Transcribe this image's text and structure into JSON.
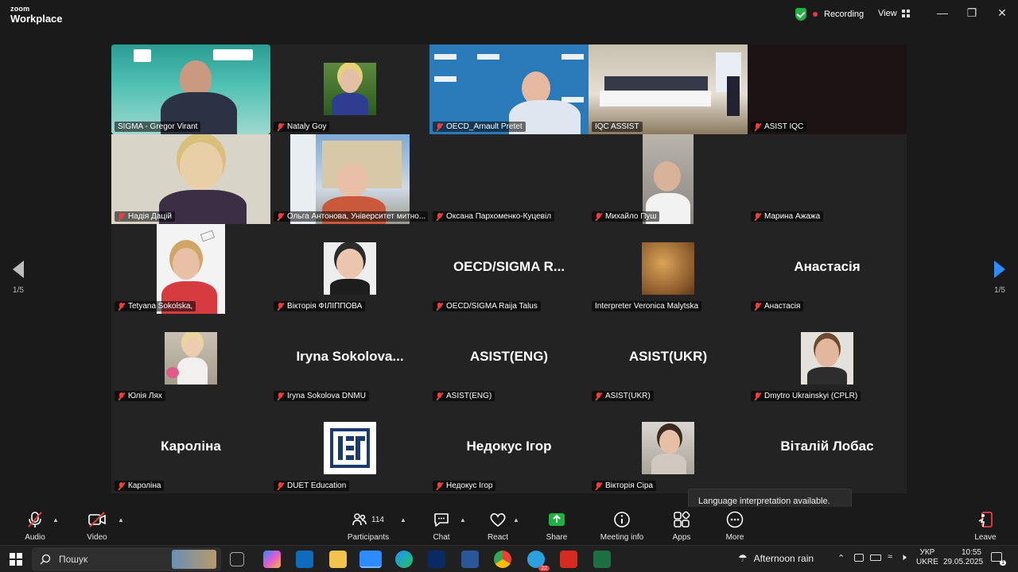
{
  "app": {
    "brand_top": "zoom",
    "brand_bottom": "Workplace"
  },
  "titlebar": {
    "recording": "Recording",
    "view": "View"
  },
  "pagination": {
    "left": "1/5",
    "right": "1/5"
  },
  "participants": [
    {
      "name": "SIGMA - Gregor Virant",
      "type": "video",
      "active": true,
      "muted": false
    },
    {
      "name": "Nataly Goy",
      "type": "photo",
      "muted": true
    },
    {
      "name": "OECD_Arnault Pretet",
      "type": "video",
      "muted": true
    },
    {
      "name": "IQC ASSIST",
      "type": "video",
      "muted": false
    },
    {
      "name": "ASIST IQC",
      "type": "dark",
      "muted": true
    },
    {
      "name": "Надія Дацій",
      "type": "video",
      "muted": true
    },
    {
      "name": "Ольга Антонова, Університет митно...",
      "type": "video",
      "muted": true
    },
    {
      "name": "Оксана Пархоменко-Куцевіл",
      "type": "blank",
      "muted": true
    },
    {
      "name": "Михайло Пуш",
      "type": "video",
      "muted": true
    },
    {
      "name": "Марина Ажажа",
      "type": "blank",
      "muted": true
    },
    {
      "name": "Tetyana Sokolska,",
      "type": "photo",
      "muted": true
    },
    {
      "name": "Вікторія ФІЛІППОВА",
      "type": "photo",
      "muted": true
    },
    {
      "name": "OECD/SIGMA Raija Talus",
      "type": "text",
      "display": "OECD/SIGMA  R...",
      "muted": true
    },
    {
      "name": "Interpreter Veronica Malytska",
      "type": "photo",
      "muted": false
    },
    {
      "name": "Анастасія",
      "type": "text",
      "display": "Анастасія",
      "muted": true
    },
    {
      "name": "Юлія Лях",
      "type": "photo",
      "muted": true
    },
    {
      "name": "Iryna Sokolova  DNMU",
      "type": "text",
      "display": "Iryna  Sokolova...",
      "muted": true
    },
    {
      "name": "ASIST(ENG)",
      "type": "text",
      "display": "ASIST(ENG)",
      "muted": true
    },
    {
      "name": "ASIST(UKR)",
      "type": "text",
      "display": "ASIST(UKR)",
      "muted": true
    },
    {
      "name": "Dmytro Ukrainskyi (CPLR)",
      "type": "photo",
      "muted": true
    },
    {
      "name": "Кароліна",
      "type": "text",
      "display": "Кароліна",
      "muted": true
    },
    {
      "name": "DUET Education",
      "type": "logo",
      "muted": true
    },
    {
      "name": "Недокус Ігор",
      "type": "text",
      "display": "Недокус Ігор",
      "muted": true
    },
    {
      "name": "Вікторія Сіра",
      "type": "photo",
      "muted": true
    },
    {
      "name": "Віталій Лобас",
      "type": "text",
      "display": "Віталій Лобас",
      "muted": true
    }
  ],
  "tooltip": {
    "text": "Language interpretation available. Click here to get started."
  },
  "toolbar": {
    "audio": "Audio",
    "video": "Video",
    "participants": "Participants",
    "participants_count": "114",
    "chat": "Chat",
    "react": "React",
    "share": "Share",
    "meeting_info": "Meeting info",
    "apps": "Apps",
    "more": "More",
    "leave": "Leave"
  },
  "taskbar": {
    "search_placeholder": "Пошук",
    "weather": "Afternoon rain",
    "lang_top": "УКР",
    "lang_bottom": "UKRE",
    "time": "10:55",
    "date": "29.05.2025",
    "notif_count": "1",
    "telegram_badge": "22"
  },
  "colors": {
    "active_speaker": "#23d959",
    "accent": "#2d8cff",
    "muted": "#e84040",
    "share": "#1fb141"
  }
}
